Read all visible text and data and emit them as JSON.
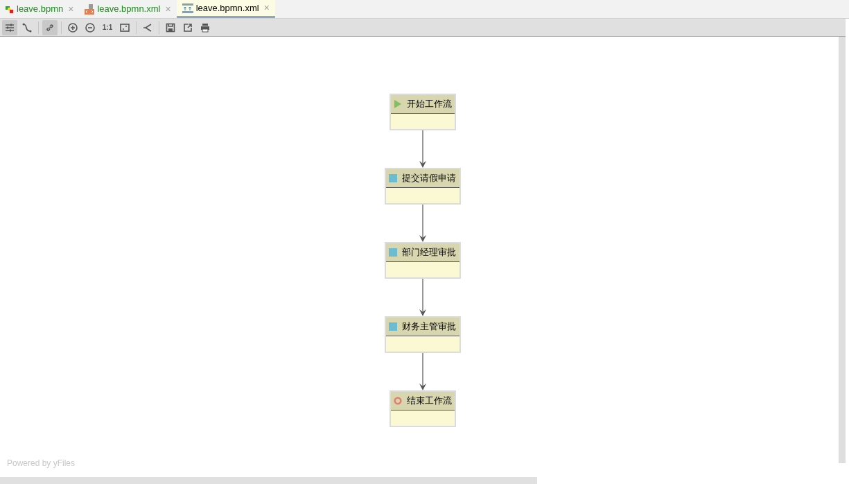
{
  "tabs": [
    {
      "label": "leave.bpmn",
      "kind": "diagram",
      "selected": false,
      "close": "×"
    },
    {
      "label": "leave.bpmn.xml",
      "kind": "xml",
      "selected": false,
      "close": "×"
    },
    {
      "label": "leave.bpmn.xml",
      "kind": "designer",
      "selected": true,
      "close": "×"
    }
  ],
  "toolbar": [
    {
      "pressed": true
    },
    {
      "pressed": false
    },
    {
      "pressed": true
    },
    {
      "pressed": false
    },
    {
      "pressed": false
    },
    {
      "label": "1:1",
      "pressed": false
    },
    {
      "pressed": false
    },
    {
      "pressed": false
    },
    {
      "pressed": false
    },
    {
      "pressed": false
    },
    {
      "pressed": false
    }
  ],
  "nodes": [
    {
      "kind": "start",
      "label": "开始工作流"
    },
    {
      "kind": "task",
      "label": "提交请假申请"
    },
    {
      "kind": "task",
      "label": "部门经理审批"
    },
    {
      "kind": "task",
      "label": "财务主管审批"
    },
    {
      "kind": "end",
      "label": "结束工作流"
    }
  ],
  "watermark": "Powered by yFiles"
}
